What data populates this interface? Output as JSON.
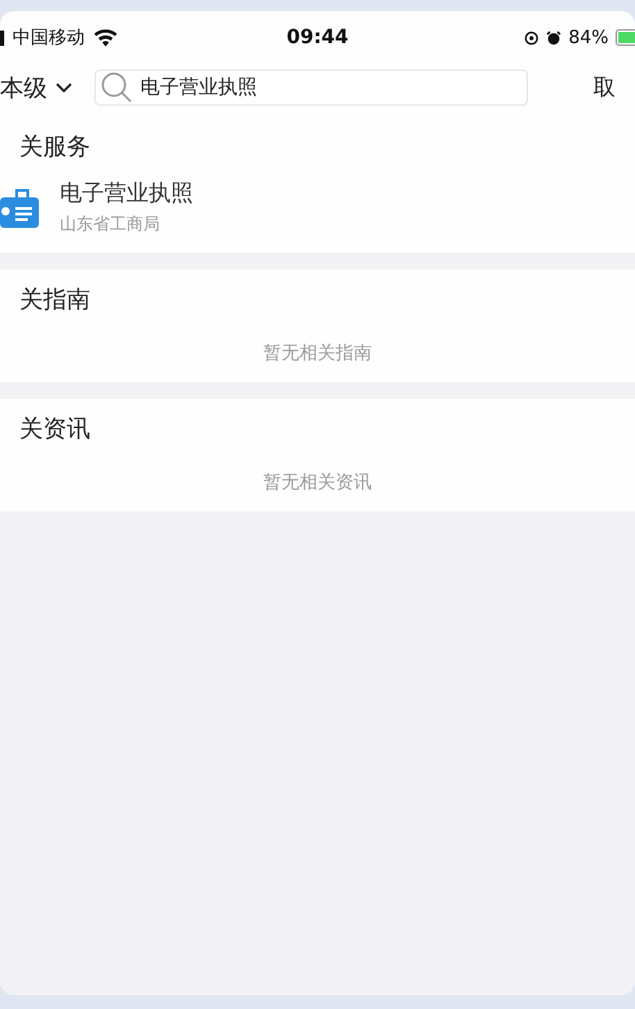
{
  "status_bar": {
    "carrier": "中国移动",
    "time": "09:44",
    "battery": "84%"
  },
  "search_bar": {
    "scope": "本级",
    "query": "电子营业执照",
    "cancel": "取"
  },
  "sections": [
    {
      "title": "关服务",
      "kind": "results",
      "items": [
        {
          "title": "电子营业执照",
          "subtitle": "山东省工商局"
        }
      ]
    },
    {
      "title": "关指南",
      "kind": "empty",
      "empty_text": "暂无相关指南"
    },
    {
      "title": "关资讯",
      "kind": "empty",
      "empty_text": "暂无相关资讯"
    }
  ]
}
